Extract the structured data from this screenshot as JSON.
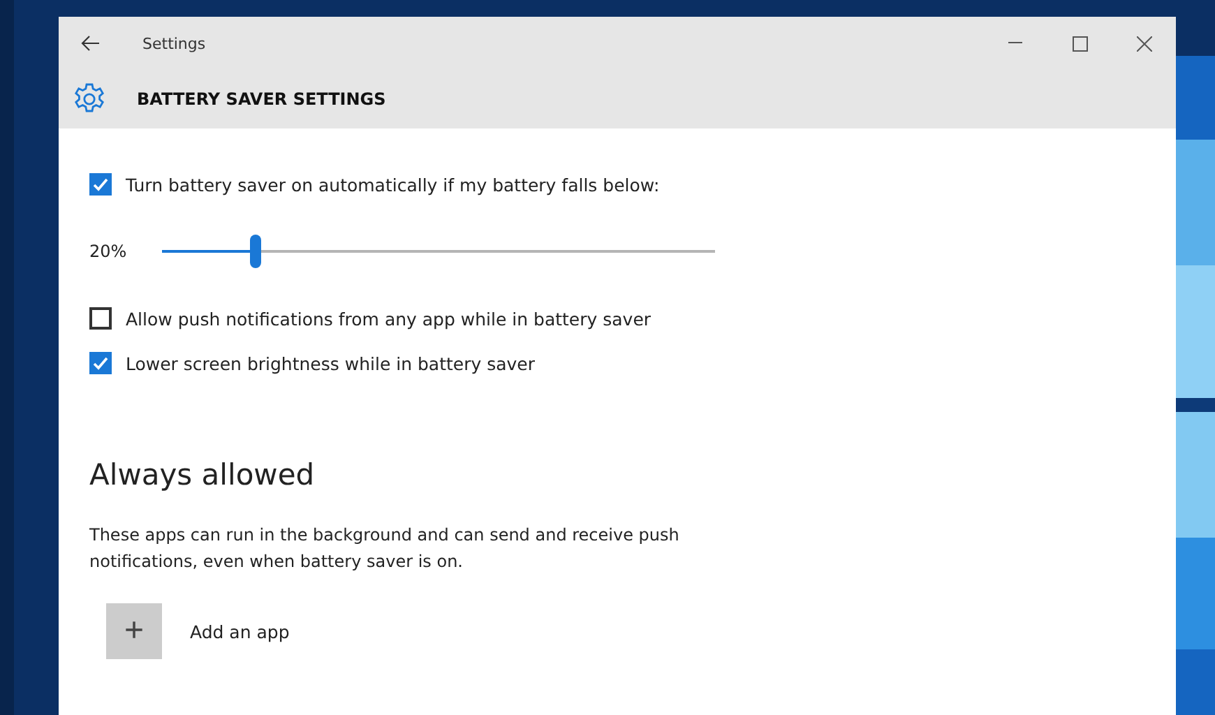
{
  "window": {
    "title": "Settings"
  },
  "header": {
    "title": "BATTERY SAVER SETTINGS"
  },
  "options": [
    {
      "kind": "checkbox",
      "label": "Turn battery saver on automatically if my battery falls below:",
      "checked": true
    },
    {
      "kind": "slider",
      "reading": "20%",
      "level": 0.17
    },
    {
      "kind": "checkbox",
      "label": "Allow push notifications from any app while in battery saver",
      "checked": false
    },
    {
      "kind": "checkbox",
      "label": "Lower screen brightness while in battery saver",
      "checked": true
    }
  ],
  "always_allowed": {
    "heading": "Always allowed",
    "description": "These apps can run in the background and can send and receive push notifications, even when battery saver is on.",
    "add_button": {
      "icon": "+",
      "label": "Add an app"
    }
  }
}
